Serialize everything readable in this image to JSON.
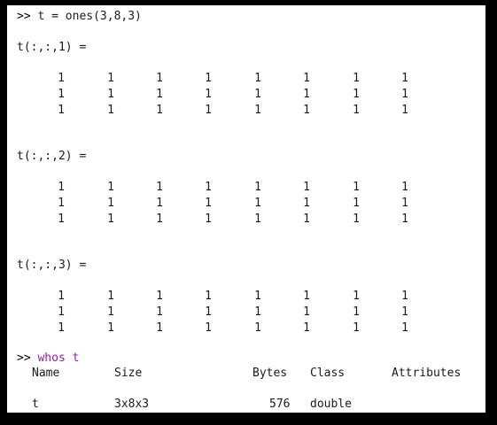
{
  "commands": {
    "ones_prompt": ">>",
    "ones_cmd": "t = ones(3,8,3)",
    "whos_prompt": ">>",
    "whos_keyword": "whos",
    "whos_arg": "t"
  },
  "pages": [
    {
      "label": "t(:,:,1) =",
      "rows": [
        [
          "1",
          "1",
          "1",
          "1",
          "1",
          "1",
          "1",
          "1"
        ],
        [
          "1",
          "1",
          "1",
          "1",
          "1",
          "1",
          "1",
          "1"
        ],
        [
          "1",
          "1",
          "1",
          "1",
          "1",
          "1",
          "1",
          "1"
        ]
      ]
    },
    {
      "label": "t(:,:,2) =",
      "rows": [
        [
          "1",
          "1",
          "1",
          "1",
          "1",
          "1",
          "1",
          "1"
        ],
        [
          "1",
          "1",
          "1",
          "1",
          "1",
          "1",
          "1",
          "1"
        ],
        [
          "1",
          "1",
          "1",
          "1",
          "1",
          "1",
          "1",
          "1"
        ]
      ]
    },
    {
      "label": "t(:,:,3) =",
      "rows": [
        [
          "1",
          "1",
          "1",
          "1",
          "1",
          "1",
          "1",
          "1"
        ],
        [
          "1",
          "1",
          "1",
          "1",
          "1",
          "1",
          "1",
          "1"
        ],
        [
          "1",
          "1",
          "1",
          "1",
          "1",
          "1",
          "1",
          "1"
        ]
      ]
    }
  ],
  "whos_table": {
    "headers": {
      "name": "Name",
      "size": "Size",
      "bytes": "Bytes",
      "class": "Class",
      "attributes": "Attributes"
    },
    "rows": [
      {
        "name": "t",
        "size": "3x8x3",
        "bytes": "576",
        "class": "double",
        "attributes": ""
      }
    ]
  },
  "colors": {
    "background": "#ffffff",
    "text": "#1a1a1a",
    "keyword": "#8b1fa8",
    "frame": "#000000"
  }
}
